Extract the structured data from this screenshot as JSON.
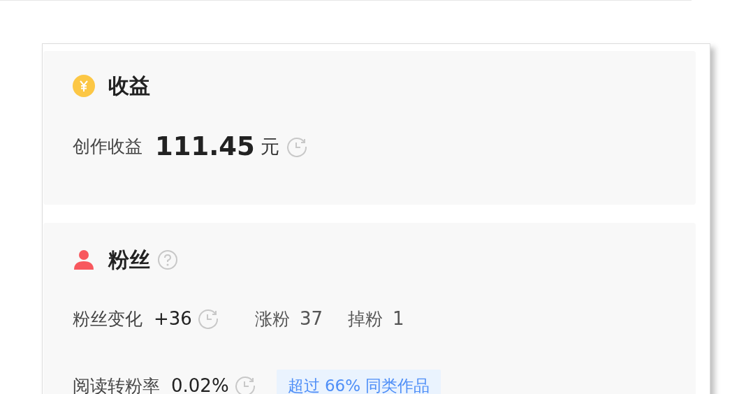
{
  "income": {
    "title": "收益",
    "label": "创作收益",
    "value": "111.45",
    "unit": "元"
  },
  "fans": {
    "title": "粉丝",
    "rows": [
      {
        "label": "粉丝变化",
        "value": "+36",
        "extras": [
          {
            "label": "涨粉",
            "value": "37"
          },
          {
            "label": "掉粉",
            "value": "1"
          }
        ]
      },
      {
        "label": "阅读转粉率",
        "value": "0.02%",
        "badge": "超过 66% 同类作品"
      }
    ]
  }
}
